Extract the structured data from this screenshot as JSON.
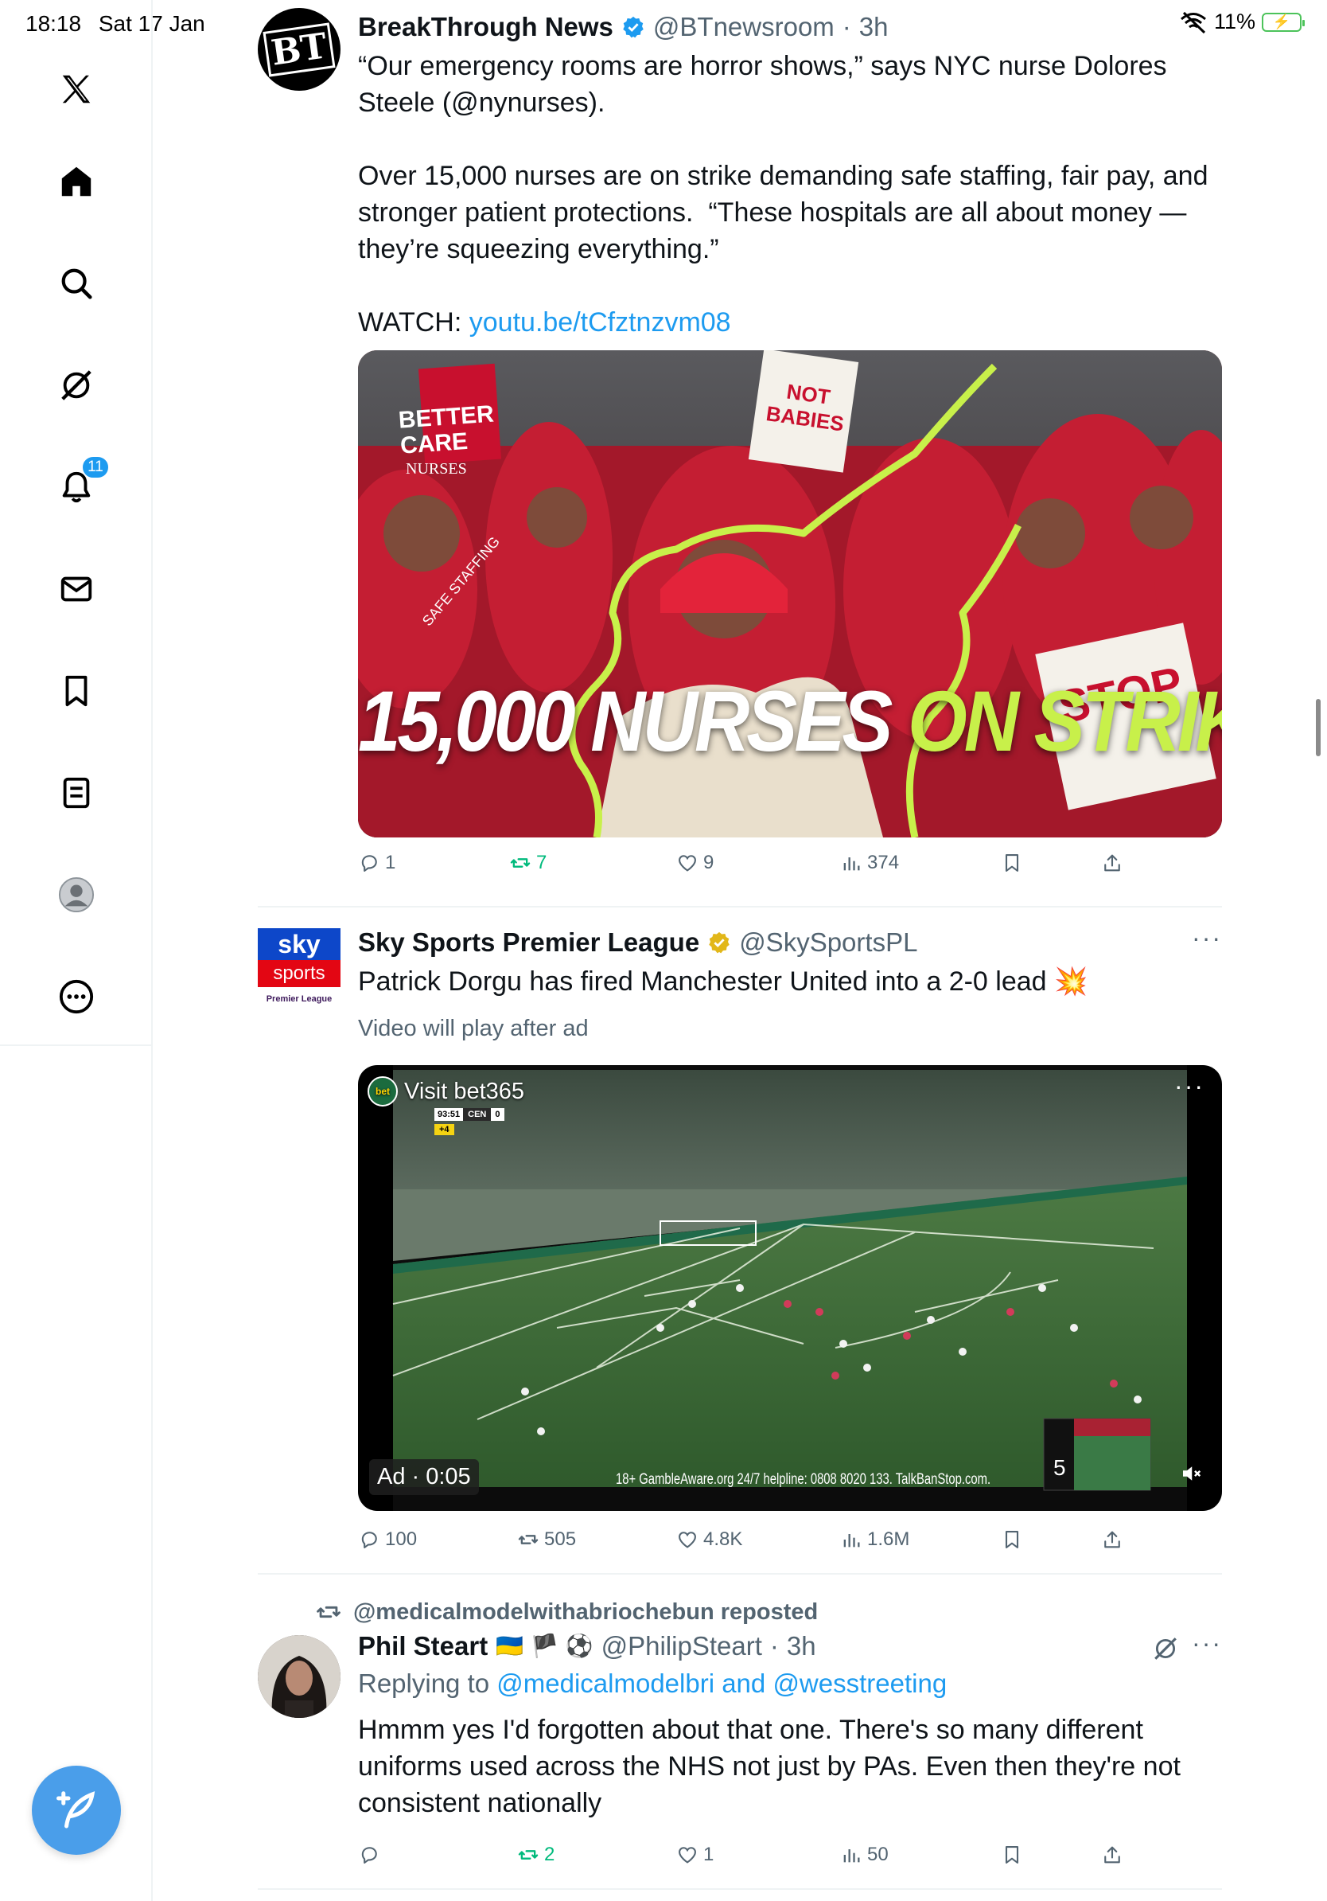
{
  "status": {
    "time": "18:18",
    "date": "Sat 17 Jan",
    "battery": "11%",
    "battery_charging": true
  },
  "sidebar": {
    "notifications_badge": "11",
    "items": [
      "x-logo",
      "home",
      "search",
      "grok",
      "notifications",
      "messages",
      "bookmarks",
      "lists",
      "profile",
      "more"
    ]
  },
  "tweets": [
    {
      "author": "BreakThrough News",
      "verified": "blue",
      "handle": "@BTnewsroom",
      "time": "3h",
      "avatar_text": "BT",
      "text_1": "“Our emergency rooms are horror shows,” says NYC nurse Dolores Steele (@nynurses).",
      "text_2": "Over 15,000 nurses are on strike demanding safe staffing, fair pay, and stronger patient protections.  “These hospitals are all about money — they’re squeezing everything.”",
      "watch_label": "WATCH: ",
      "link": "youtu.be/tCfztnzvm08",
      "image_caption_white": "15,000 NURSES",
      "image_caption_green": "ON STRIKE",
      "image_signs": [
        "BETTER CARE",
        "NURSES",
        "NOT BABIES",
        "STOP",
        "SAFE STAFFING"
      ],
      "replies": "1",
      "reposts": "7",
      "likes": "9",
      "views": "374"
    },
    {
      "author": "Sky Sports Premier League",
      "verified": "gold",
      "handle": "@SkySportsPL",
      "avatar_top": "sky",
      "avatar_mid": "sports",
      "avatar_bottom": "Premier League",
      "text": "Patrick Dorgu has fired Manchester United into a 2-0 lead",
      "text_emoji": "💥",
      "video_note": "Video will play after ad",
      "ad_label": "Visit bet365",
      "ad_timer": "Ad · 0:05",
      "scoreboard_time": "93:51",
      "scoreboard_team": "CEN",
      "scoreboard_score": "0",
      "scoreboard_added": "+4",
      "gamble_notice": "18+ GambleAware.org 24/7 helpline: 0808 8020 133. TalkBanStop.com.",
      "skip_count": "5",
      "replies": "100",
      "reposts": "505",
      "likes": "4.8K",
      "views": "1.6M"
    },
    {
      "repost_label": "@medicalmodelwithabriochebun reposted",
      "author": "Phil Steart",
      "flags": "🇺🇦 🏴 ⚽",
      "handle": "@PhilipSteart",
      "time": "3h",
      "reply_prefix": "Replying to ",
      "reply_to_1": "@medicalmodelbri",
      "reply_and": " and ",
      "reply_to_2": "@wesstreeting",
      "text": "Hmmm yes I'd forgotten about that one. There's so many different uniforms used across the NHS not just by PAs. Even then they're not consistent nationally",
      "replies": "",
      "reposts": "2",
      "likes": "1",
      "views": "50"
    }
  ],
  "colors": {
    "accent": "#1d9bf0",
    "repost_green": "#00ba7c",
    "strike_green": "#c8f04a",
    "strike_red": "#d7263d",
    "pitch_green": "#3e6b3a"
  }
}
